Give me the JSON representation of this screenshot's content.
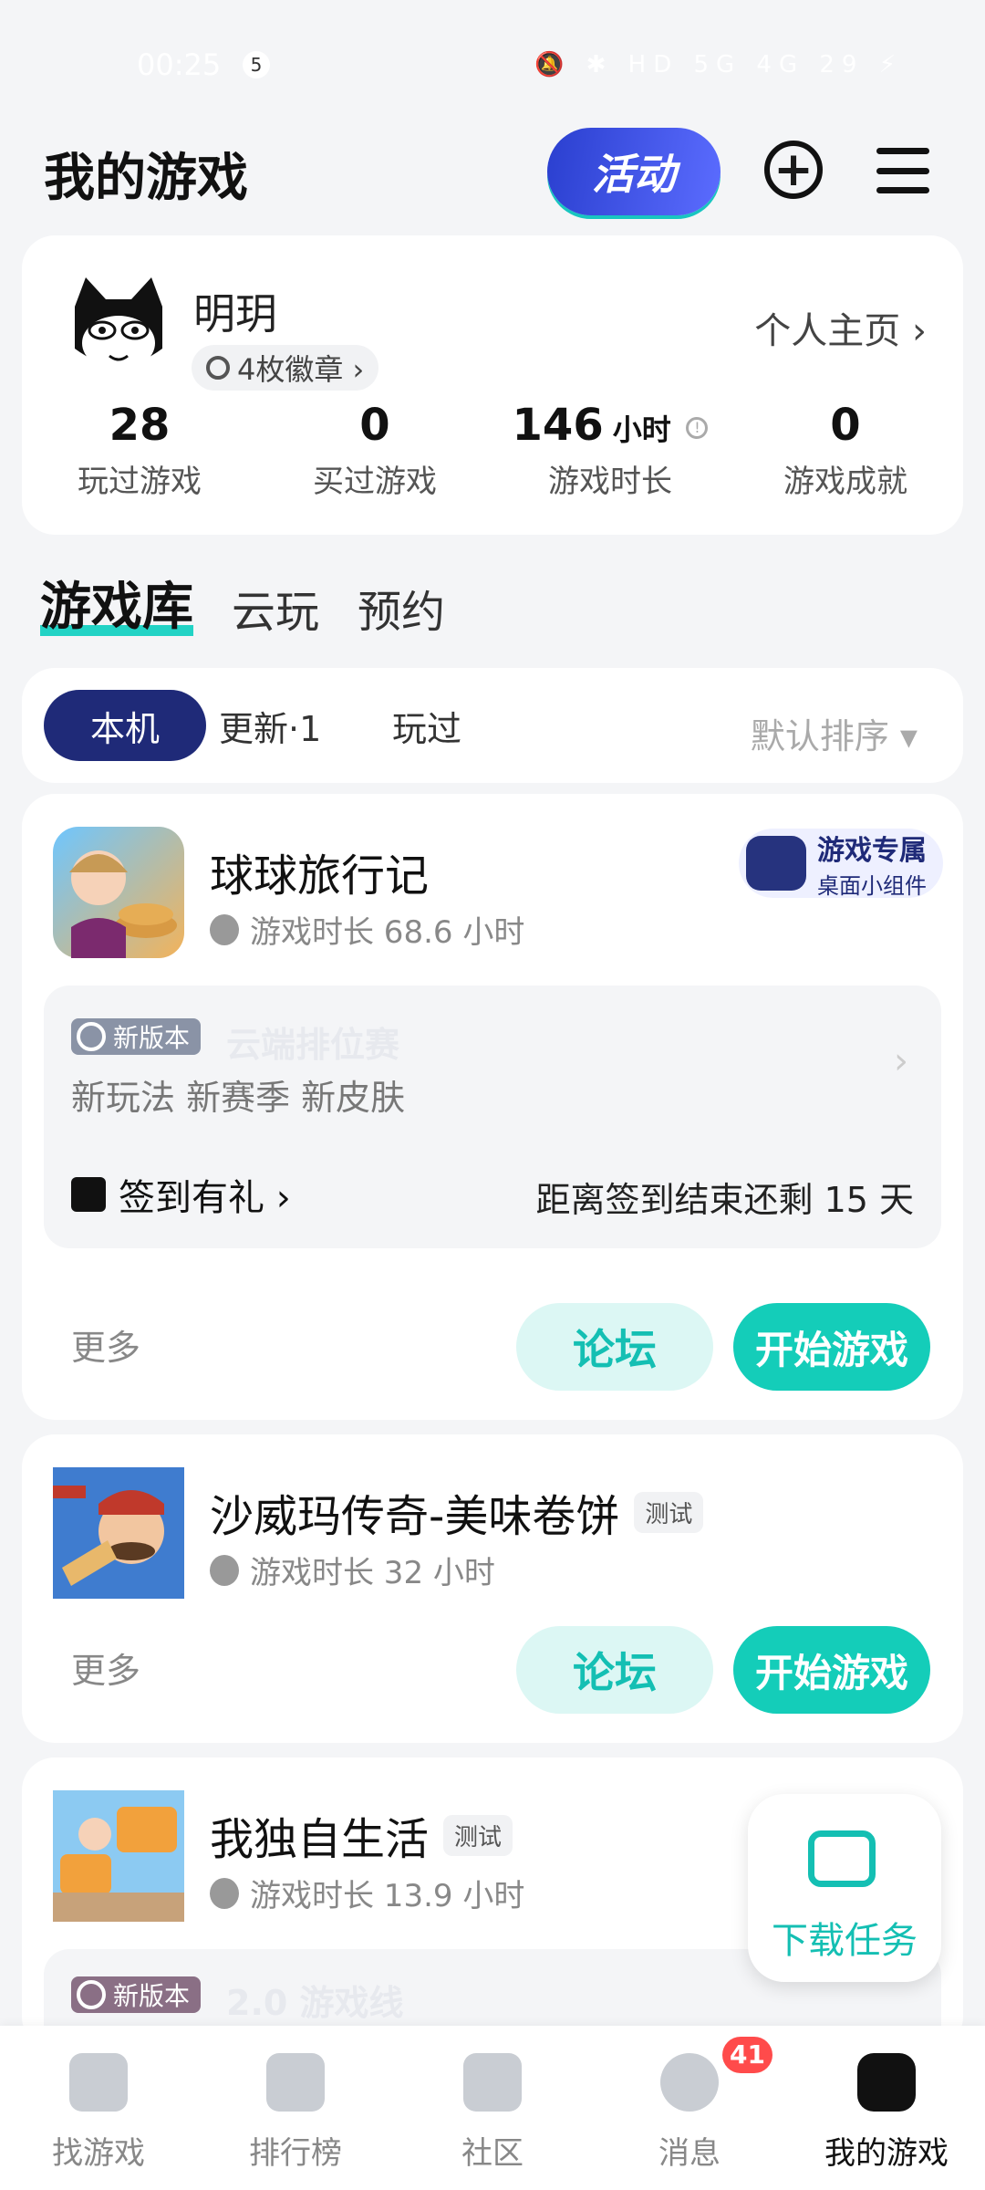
{
  "status_bar": {
    "time": "00:25",
    "notif_count": "5",
    "icons": "🔕 ✱ HD 5G 4G 29 ⚡"
  },
  "header": {
    "title": "我的游戏",
    "activity_label": "活动"
  },
  "profile": {
    "name": "明玥",
    "badges": "4枚徽章 ›",
    "homepage": "个人主页 ›",
    "stats": [
      {
        "num": "28",
        "unit": "",
        "label": "玩过游戏"
      },
      {
        "num": "0",
        "unit": "",
        "label": "买过游戏"
      },
      {
        "num": "146",
        "unit": "小时",
        "label": "游戏时长"
      },
      {
        "num": "0",
        "unit": "",
        "label": "游戏成就"
      }
    ]
  },
  "library_tabs": [
    "游戏库",
    "云玩",
    "预约"
  ],
  "filters": {
    "chips": [
      "本机",
      "更新·1",
      "玩过"
    ],
    "sort": "默认排序 ▾"
  },
  "games": [
    {
      "title": "球球旅行记",
      "tag": "",
      "time": "游戏时长 68.6 小时",
      "widget_title": "游戏专属",
      "widget_sub": "桌面小组件",
      "version_badge": "新版本",
      "version_title": "云端排位赛",
      "version_desc": "新玩法 新赛季 新皮肤",
      "signin_label": "签到有礼 ›",
      "signin_right": "距离签到结束还剩 15 天",
      "more": "更多",
      "forum": "论坛",
      "play": "开始游戏"
    },
    {
      "title": "沙威玛传奇-美味卷饼",
      "tag": "测试",
      "time": "游戏时长 32 小时",
      "more": "更多",
      "forum": "论坛",
      "play": "开始游戏"
    },
    {
      "title": "我独自生活",
      "tag": "测试",
      "time": "游戏时长 13.9 小时",
      "version_badge": "新版本",
      "version_title": "2.0 游戏线"
    }
  ],
  "float_button": {
    "label": "下载任务"
  },
  "bottom_nav": [
    {
      "label": "找游戏",
      "badge": ""
    },
    {
      "label": "排行榜",
      "badge": ""
    },
    {
      "label": "社区",
      "badge": ""
    },
    {
      "label": "消息",
      "badge": "41"
    },
    {
      "label": "我的游戏",
      "badge": ""
    }
  ],
  "colors": {
    "accent": "#14cdb9",
    "navy": "#1f2a78",
    "badge_red": "#ff4b4b"
  }
}
